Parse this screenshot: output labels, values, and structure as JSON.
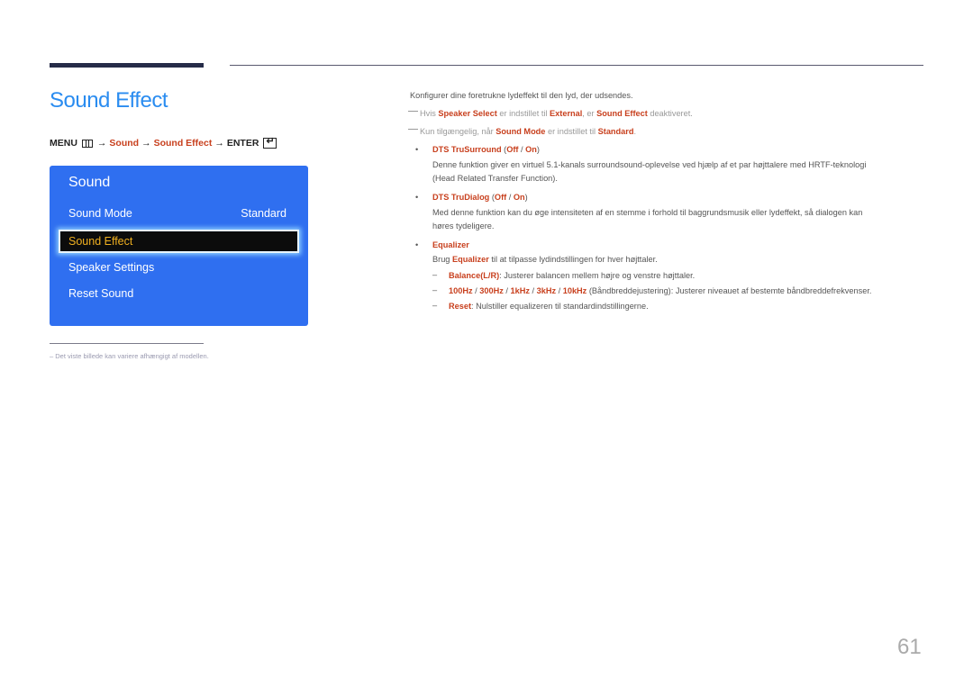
{
  "title": "Sound Effect",
  "menu_path": {
    "menu": "MENU",
    "arrow": "→",
    "step1": "Sound",
    "step2": "Sound Effect",
    "enter": "ENTER"
  },
  "osd": {
    "title": "Sound",
    "items": [
      {
        "label": "Sound Mode",
        "value": "Standard"
      },
      {
        "label": "Sound Effect",
        "selected": true
      },
      {
        "label": "Speaker Settings"
      },
      {
        "label": "Reset Sound"
      }
    ]
  },
  "footnote": "Det viste billede kan variere afhængigt af modellen.",
  "content": {
    "intro": "Konfigurer dine foretrukne lydeffekt til den lyd, der udsendes.",
    "note1": {
      "a": "Hvis ",
      "b": "Speaker Select",
      "c": " er indstillet til ",
      "d": "External",
      "e": ", er ",
      "f": "Sound Effect",
      "g": " deaktiveret."
    },
    "note2": {
      "a": "Kun tilgængelig, når ",
      "b": "Sound Mode",
      "c": " er indstillet til ",
      "d": "Standard",
      "e": "."
    },
    "items": [
      {
        "title": "DTS TruSurround",
        "off": "Off",
        "on": "On",
        "desc1": "Denne funktion giver en virtuel 5.1-kanals surroundsound-oplevelse ved hjælp af et par højttalere med HRTF-teknologi",
        "desc2": "(Head Related Transfer Function)."
      },
      {
        "title": "DTS TruDialog",
        "off": "Off",
        "on": "On",
        "desc1": "Med denne funktion kan du øge intensiteten af en stemme i forhold til baggrundsmusik eller lydeffekt, så dialogen kan",
        "desc2": "høres tydeligere."
      },
      {
        "title": "Equalizer",
        "desc_a": "Brug ",
        "desc_b": "Equalizer",
        "desc_c": " til at tilpasse lydindstillingen for hver højttaler."
      }
    ],
    "eq": {
      "balance": {
        "label": "Balance(L/R)",
        "text": ": Justerer balancen mellem højre og venstre højttaler."
      },
      "bands": {
        "b1": "100Hz",
        "b2": "300Hz",
        "b3": "1kHz",
        "b4": "3kHz",
        "b5": "10kHz",
        "text": " (Båndbreddejustering): Justerer niveauet af bestemte båndbreddefrekvenser."
      },
      "reset": {
        "label": "Reset",
        "text": ": Nulstiller equalizeren til standardindstillingerne."
      }
    }
  },
  "page_number": "61"
}
